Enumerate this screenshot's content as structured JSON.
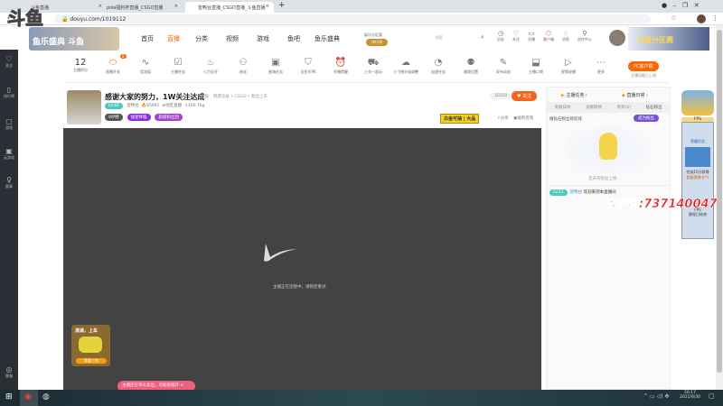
{
  "browser": {
    "tabs": [
      {
        "label": "斗鱼直播",
        "active": false
      },
      {
        "label": "pika福利杯直播_CSGO直播",
        "active": false
      },
      {
        "label": "皆鸭台直播_CSGO直播_斗鱼直播",
        "active": true
      }
    ],
    "new_tab": "+",
    "url": "douyu.com/1019112"
  },
  "watermark": {
    "logo": "斗鱼",
    "qq_group": "水友群:737140047"
  },
  "header": {
    "nav": [
      "首页",
      "直播",
      "分类",
      "视频",
      "游戏",
      "鱼吧",
      "鱼乐盛典"
    ],
    "active": "直播",
    "promo": "娱乐分区赛",
    "promo_btn": "排行榜",
    "search_placeholder": "搜索",
    "icons": [
      {
        "name": "history",
        "label": "历史"
      },
      {
        "name": "follow",
        "label": "关注"
      },
      {
        "name": "broadcast",
        "label": "开播"
      },
      {
        "name": "fanclub",
        "label": "客户端"
      },
      {
        "name": "bell",
        "label": "消息"
      },
      {
        "name": "creator",
        "label": "创作中心"
      }
    ],
    "banner": "年度分区赛"
  },
  "sidebar": [
    {
      "icon": "heart",
      "label": "关注"
    },
    {
      "icon": "rank",
      "label": "排行榜"
    },
    {
      "icon": "game",
      "label": "游戏"
    },
    {
      "icon": "cloud-game",
      "label": "云游戏"
    },
    {
      "icon": "trophy",
      "label": "赛事"
    },
    {
      "icon": "headset",
      "label": "客服"
    }
  ],
  "toolbar": {
    "level": "12",
    "level_label": "主播积分",
    "switch_badge": "8",
    "items": [
      "直播开关",
      "音浪值",
      "主播任务",
      "火力全开",
      "粉丝",
      "星海任务",
      "全民乐PK",
      "开播提醒",
      "上车一起玩",
      "小飞猪分成调整",
      "加速任务",
      "福袋设置",
      "发布动态",
      "主播口袋",
      "视频轮播",
      "更多"
    ],
    "pc_client": "PC客户端",
    "pc_note": "主播功能已上线"
  },
  "room": {
    "title": "感谢大家的努力，1W关注达成",
    "report": "举报",
    "category": "网游竞技 • CSGO • 斯坦上车",
    "badge": "LV.40",
    "owner": "皆鸭台",
    "hot": "85991",
    "location": "地区直播",
    "weight": "160.7kg",
    "vip": "VIP特",
    "tag1": "福星降临",
    "tag2": "超级粉丝团",
    "followers": "10250",
    "follow_btn": "关注",
    "ad": "白金可抽 | 大品",
    "share": "分享",
    "download": "福利签到"
  },
  "video": {
    "loading_text": "主播正在连接中，请稍后重试",
    "car_title": "滴滴，上车",
    "car_btn": "我要上车",
    "toast": "主播还在带头卖出，可能很慢开"
  },
  "right_panel": {
    "tab_top": [
      "主播任务",
      "直播日常"
    ],
    "tabs": [
      "贡献日榜",
      "贡献周榜",
      "贵宾(0)",
      "钻石粉丝"
    ],
    "rank_title": "做钻石粉丝榜前排",
    "rank_btn": "成为粉丝",
    "empty": "还未有粉丝上榜",
    "chat": {
      "badge": "LV.23",
      "user": "皆鸭台",
      "msg": "欢迎来到本直播间"
    }
  },
  "ad_column": {
    "label": "FPS",
    "title": "荣耀任务",
    "desc": "完成15分获得",
    "desc2": "超级荣誉卡*1",
    "bottom": "FPS",
    "bottom2": "赛程已结束"
  },
  "taskbar": {
    "time": "20:17",
    "date": "2021/8/30"
  }
}
